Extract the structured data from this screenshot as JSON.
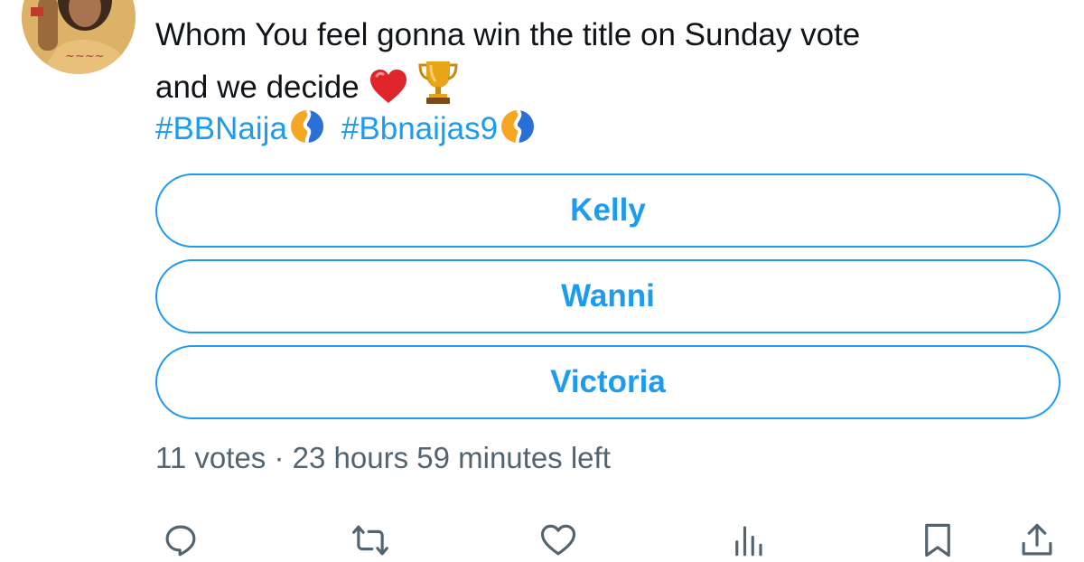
{
  "tweet": {
    "text_line1": "Whom You feel gonna win the title on Sunday vote",
    "text_line2": "and we decide",
    "emojis": [
      "red-heart",
      "trophy"
    ],
    "hashtags": [
      {
        "text": "#BBNaija",
        "emoji": "bbnaija-logo"
      },
      {
        "text": "#Bbnaijas9",
        "emoji": "bbnaija-logo"
      }
    ]
  },
  "poll": {
    "options": [
      {
        "label": "Kelly"
      },
      {
        "label": "Wanni"
      },
      {
        "label": "Victoria"
      }
    ],
    "votes": "11 votes",
    "separator": "·",
    "time_left": "23 hours 59 minutes left"
  },
  "actions": [
    {
      "name": "reply",
      "icon": "reply-icon"
    },
    {
      "name": "retweet",
      "icon": "retweet-icon"
    },
    {
      "name": "like",
      "icon": "heart-icon"
    },
    {
      "name": "views",
      "icon": "analytics-icon"
    },
    {
      "name": "bookmark",
      "icon": "bookmark-icon"
    },
    {
      "name": "share",
      "icon": "share-icon"
    }
  ],
  "colors": {
    "accent": "#1d9bf0",
    "text": "#0f1419",
    "muted": "#536471"
  }
}
